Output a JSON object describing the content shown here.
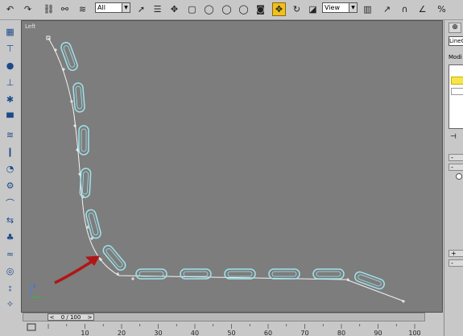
{
  "toolbar": {
    "selection_filter": "All",
    "reference_coord": "View",
    "icons": [
      "undo-icon",
      "redo-icon",
      "select-link-icon",
      "unlink-icon",
      "bind-space-warp-icon",
      "select-object-icon",
      "select-by-name-icon",
      "rect-region-icon",
      "circle-region-icon",
      "fence-region-icon",
      "lasso-region-icon",
      "paint-region-icon",
      "window-crossing-icon",
      "select-move-icon",
      "select-rotate-icon",
      "select-scale-icon",
      "pivot-icon",
      "select-manipulate-icon",
      "snap-3d-icon",
      "angle-snap-icon",
      "percent-snap-icon"
    ]
  },
  "viewport": {
    "label": "Left",
    "axis_label": "z"
  },
  "right_panel": {
    "modifier_list": "LineO",
    "modifier_label": "Modi",
    "row_symbols": [
      "-",
      "-",
      "+",
      "-"
    ]
  },
  "timeline": {
    "frame_counter": "0 / 100",
    "ticks": [
      "10",
      "20",
      "30",
      "40",
      "50",
      "60",
      "70",
      "80",
      "90",
      "100"
    ]
  },
  "colors": {
    "viewport_bg": "#7d7d7d",
    "spline": "#f4f4f4",
    "object_outline": "#9fe3ec",
    "annotation_arrow": "#b01616",
    "active_tool": "#f0c020"
  }
}
